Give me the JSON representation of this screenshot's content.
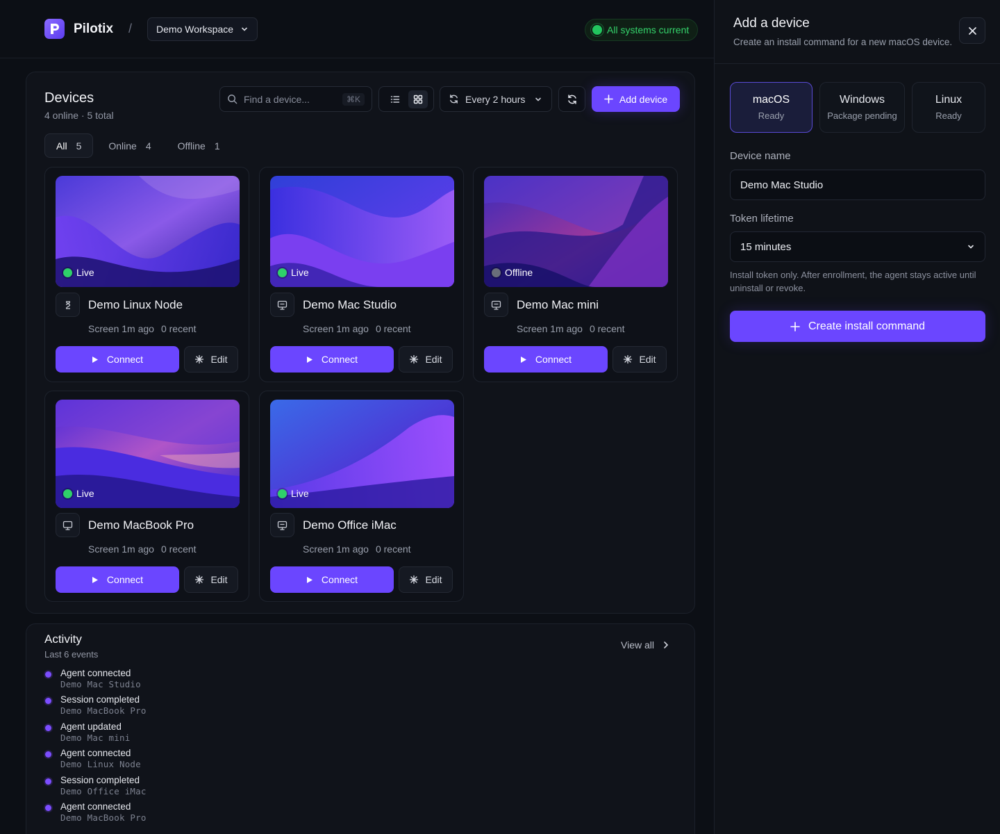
{
  "header": {
    "brand": "Pilotix",
    "separator": "/",
    "workspace": "Demo Workspace",
    "system_status": "All systems current"
  },
  "devices": {
    "title": "Devices",
    "online_label": "4 online",
    "dot": "·",
    "total_label": "5 total",
    "search_placeholder": "Find a device...",
    "search_shortcut": "⌘K",
    "interval": "Every 2 hours",
    "add_button": "Add device",
    "filters": [
      {
        "label": "All",
        "count": "5"
      },
      {
        "label": "Online",
        "count": "4"
      },
      {
        "label": "Offline",
        "count": "1"
      }
    ],
    "cards": [
      {
        "name": "Demo Linux Node",
        "status": "Live",
        "screen": "Screen 1m ago",
        "recent": "0 recent",
        "connect": "Connect",
        "edit": "Edit",
        "icon": "linux-icon"
      },
      {
        "name": "Demo Mac Studio",
        "status": "Live",
        "screen": "Screen 1m ago",
        "recent": "0 recent",
        "connect": "Connect",
        "edit": "Edit",
        "icon": "monitor-icon"
      },
      {
        "name": "Demo Mac mini",
        "status": "Offline",
        "screen": "Screen 1m ago",
        "recent": "0 recent",
        "connect": "Connect",
        "edit": "Edit",
        "icon": "monitor-icon"
      },
      {
        "name": "Demo MacBook Pro",
        "status": "Live",
        "screen": "Screen 1m ago",
        "recent": "0 recent",
        "connect": "Connect",
        "edit": "Edit",
        "icon": "monitor-icon"
      },
      {
        "name": "Demo Office iMac",
        "status": "Live",
        "screen": "Screen 1m ago",
        "recent": "0 recent",
        "connect": "Connect",
        "edit": "Edit",
        "icon": "monitor-icon"
      }
    ]
  },
  "activity": {
    "title": "Activity",
    "subtitle": "Last 6 events",
    "view_all": "View all",
    "events": [
      {
        "title": "Agent connected",
        "device": "Demo Mac Studio"
      },
      {
        "title": "Session completed",
        "device": "Demo MacBook Pro"
      },
      {
        "title": "Agent updated",
        "device": "Demo Mac mini"
      },
      {
        "title": "Agent connected",
        "device": "Demo Linux Node"
      },
      {
        "title": "Session completed",
        "device": "Demo Office iMac"
      },
      {
        "title": "Agent connected",
        "device": "Demo MacBook Pro"
      }
    ]
  },
  "drawer": {
    "title": "Add a device",
    "subtitle": "Create an install command for a new macOS device.",
    "os_tabs": [
      {
        "name": "macOS",
        "status": "Ready"
      },
      {
        "name": "Windows",
        "status": "Package pending"
      },
      {
        "name": "Linux",
        "status": "Ready"
      }
    ],
    "device_name_label": "Device name",
    "device_name_value": "Demo Mac Studio",
    "token_label": "Token lifetime",
    "token_value": "15 minutes",
    "hint": "Install token only. After enrollment, the agent stays active until uninstall or revoke.",
    "create_button": "Create install command"
  },
  "colors": {
    "accent": "#6b46ff",
    "live": "#2fd06a",
    "offline": "#6a6e7a",
    "status_green": "#34d36b",
    "background": "#0c0f15"
  }
}
